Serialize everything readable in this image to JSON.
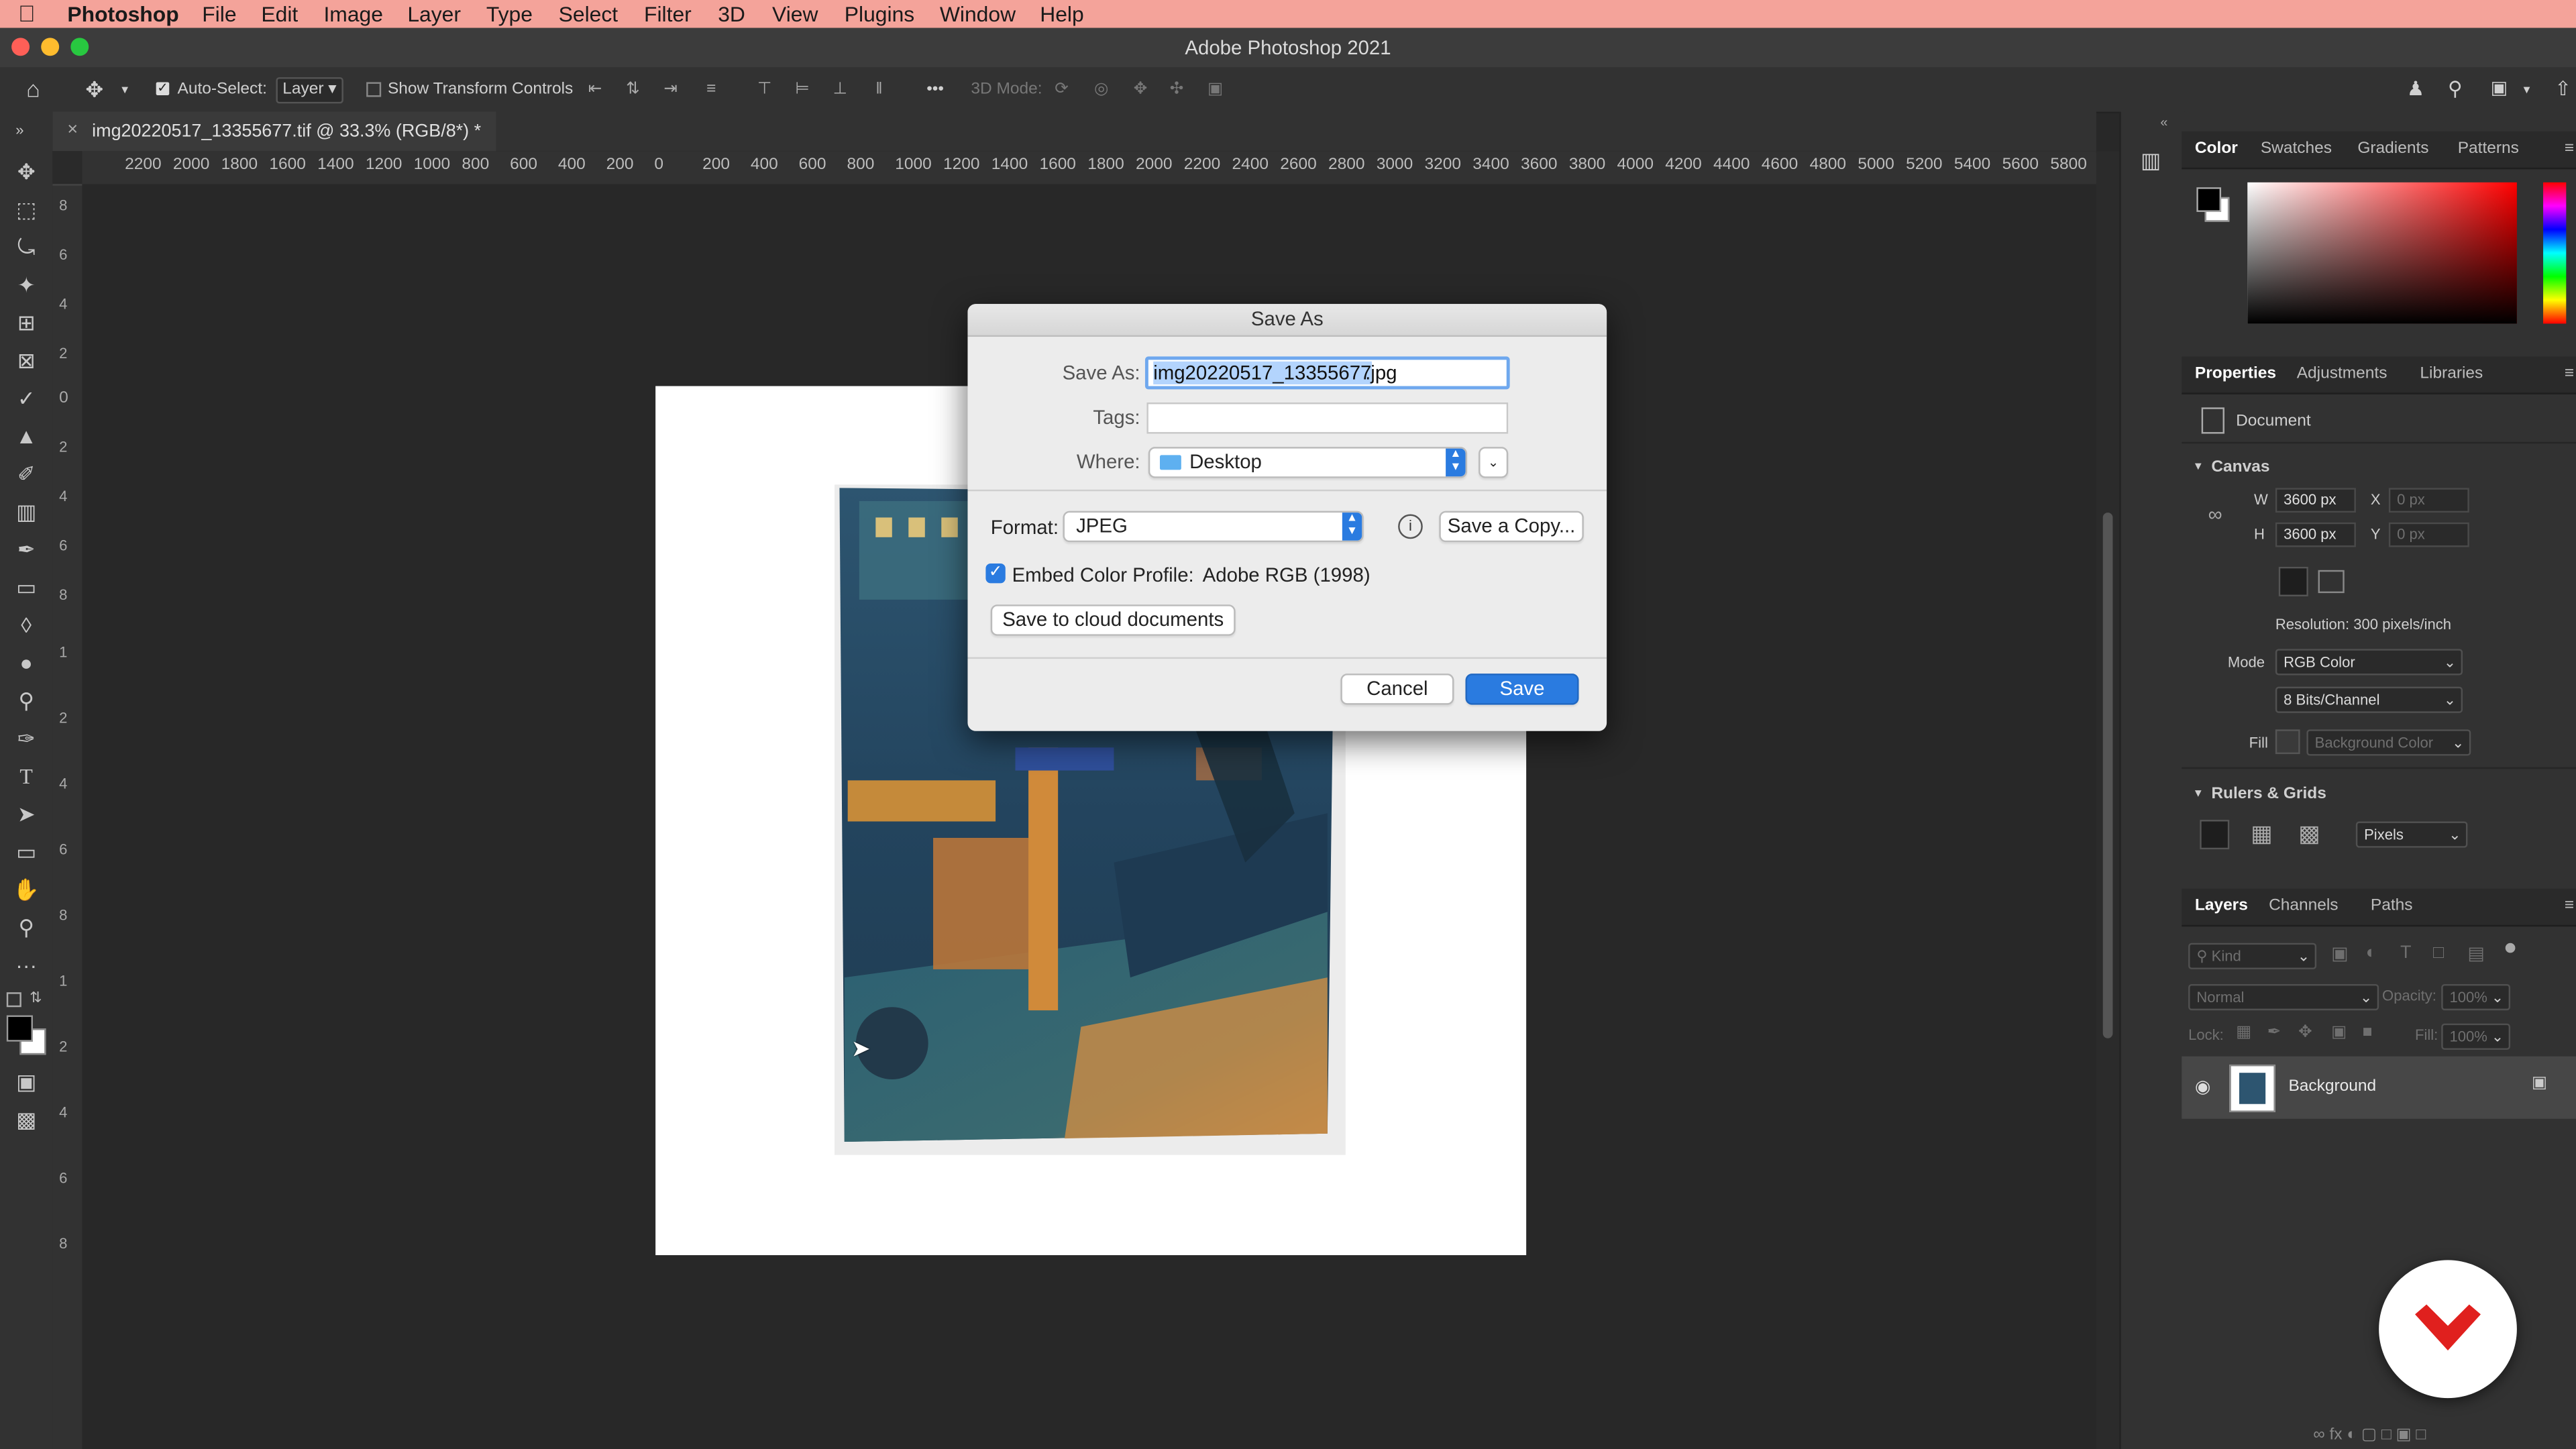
{
  "menubar": {
    "app": "Photoshop",
    "items": [
      "File",
      "Edit",
      "Image",
      "Layer",
      "Type",
      "Select",
      "Filter",
      "3D",
      "View",
      "Plugins",
      "Window",
      "Help"
    ]
  },
  "window": {
    "title": "Adobe Photoshop 2021"
  },
  "options": {
    "auto_select_label": "Auto-Select:",
    "auto_select_value": "Layer",
    "transform_label": "Show Transform Controls",
    "mode3d_label": "3D Mode:",
    "more": "•••"
  },
  "doc": {
    "tab_title": "img20220517_13355677.tif @ 33.3% (RGB/8*) *",
    "close": "×"
  },
  "ruler": {
    "h_ticks": [
      "2200",
      "2000",
      "1800",
      "1600",
      "1400",
      "1200",
      "1000",
      "800",
      "600",
      "400",
      "200",
      "0",
      "200",
      "400",
      "600",
      "800",
      "1000",
      "1200",
      "1400",
      "1600",
      "1800",
      "2000",
      "2200",
      "2400",
      "2600",
      "2800",
      "3000",
      "3200",
      "3400",
      "3600",
      "3800",
      "4000",
      "4200",
      "4400",
      "4600",
      "4800",
      "5000",
      "5200",
      "5400",
      "5600",
      "5800"
    ],
    "v_ticks": [
      "8",
      "6",
      "4",
      "2",
      "0",
      "2",
      "4",
      "6",
      "8",
      "1",
      "2",
      "4",
      "6",
      "8",
      "1",
      "2",
      "4",
      "6",
      "8"
    ]
  },
  "dialog": {
    "title": "Save As",
    "save_as_label": "Save As:",
    "filename_selected": "img20220517_13355677",
    "filename_ext": ".jpg",
    "tags_label": "Tags:",
    "where_label": "Where:",
    "where_value": "Desktop",
    "format_label": "Format:",
    "format_value": "JPEG",
    "save_copy_label": "Save a Copy...",
    "embed_label": "Embed Color Profile:",
    "embed_value": "Adobe RGB (1998)",
    "cloud_label": "Save to cloud documents",
    "cancel_label": "Cancel",
    "save_label": "Save"
  },
  "color_panel": {
    "tabs": [
      "Color",
      "Swatches",
      "Gradients",
      "Patterns"
    ]
  },
  "properties": {
    "tabs": [
      "Properties",
      "Adjustments",
      "Libraries"
    ],
    "doc_label": "Document",
    "canvas_heading": "Canvas",
    "w_label": "W",
    "w_value": "3600 px",
    "h_label": "H",
    "h_value": "3600 px",
    "x_label": "X",
    "x_value": "0 px",
    "y_label": "Y",
    "y_value": "0 px",
    "resolution": "Resolution: 300 pixels/inch",
    "mode_label": "Mode",
    "mode_value": "RGB Color",
    "bits_value": "8 Bits/Channel",
    "fill_label": "Fill",
    "fill_value": "Background Color",
    "rulers_heading": "Rulers & Grids",
    "units_value": "Pixels"
  },
  "layers": {
    "tabs": [
      "Layers",
      "Channels",
      "Paths"
    ],
    "kind_placeholder": "Kind",
    "blend_value": "Normal",
    "opacity_label": "Opacity:",
    "opacity_value": "100%",
    "lock_label": "Lock:",
    "fill_label": "Fill:",
    "fill_value": "100%",
    "layer_name": "Background"
  },
  "colors": {
    "menubar_bg": "#f4a39a",
    "accent_blue": "#2a7be0",
    "logo_red": "#e0201e"
  }
}
